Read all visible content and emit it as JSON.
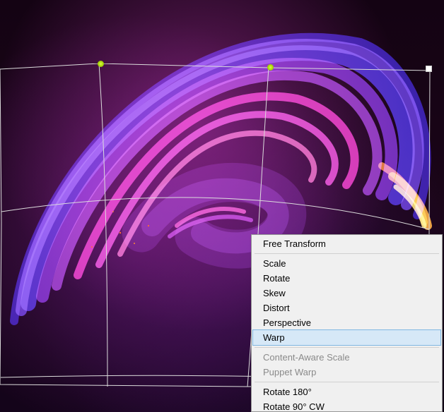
{
  "menu": {
    "header": "Free Transform",
    "items": [
      {
        "label": "Scale",
        "enabled": true,
        "selected": false
      },
      {
        "label": "Rotate",
        "enabled": true,
        "selected": false
      },
      {
        "label": "Skew",
        "enabled": true,
        "selected": false
      },
      {
        "label": "Distort",
        "enabled": true,
        "selected": false
      },
      {
        "label": "Perspective",
        "enabled": true,
        "selected": false
      },
      {
        "label": "Warp",
        "enabled": true,
        "selected": true
      },
      {
        "label": "Content-Aware Scale",
        "enabled": false,
        "selected": false
      },
      {
        "label": "Puppet Warp",
        "enabled": false,
        "selected": false
      },
      {
        "label": "Rotate 180°",
        "enabled": true,
        "selected": false
      },
      {
        "label": "Rotate 90° CW",
        "enabled": true,
        "selected": false
      }
    ]
  },
  "icons": {
    "anchor": "anchor-point",
    "handle": "transform-handle"
  },
  "colors": {
    "grid": "#dcdcdc",
    "menu_bg": "#f0f0f0",
    "menu_border": "#979797",
    "menu_highlight_bg": "#d6e8f7",
    "menu_highlight_border": "#7fb7e2",
    "disabled_text": "#8a8a8a"
  }
}
